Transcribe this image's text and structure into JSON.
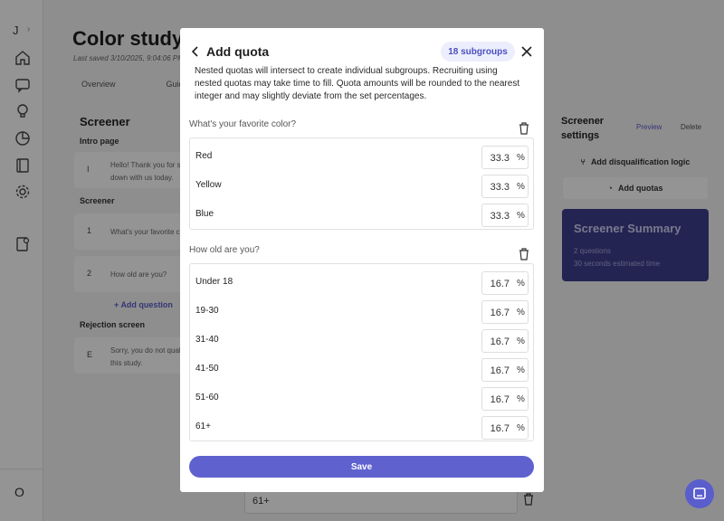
{
  "rail": {
    "workspace_initial": "J",
    "user_initial": "O",
    "icons": [
      "home-icon",
      "chat-icon",
      "lightbulb-icon",
      "pie-chart-icon",
      "book-icon",
      "gear-icon",
      "document-user-icon"
    ]
  },
  "page": {
    "title": "Color study",
    "last_saved": "Last saved 3/10/2025, 9:04:06 PM",
    "tabs": [
      "Overview",
      "Guide"
    ]
  },
  "screener": {
    "heading": "Screener",
    "intro_label": "Intro page",
    "intro_num": "I",
    "intro_text": "Hello! Thank you for sitting down with us today.",
    "screener_label": "Screener",
    "q1_num": "1",
    "q1_text": "What's your favorite color?",
    "q2_num": "2",
    "q2_text": "How old are you?",
    "add_question": "Add question",
    "rejection_label": "Rejection screen",
    "rejection_num": "E",
    "rejection_text": "Sorry, you do not qualify for this study.",
    "bottom_field_value": "61+"
  },
  "settings": {
    "title": "Screener settings",
    "preview": "Preview",
    "delete": "Delete",
    "add_disqualification": "Add disqualification logic",
    "add_quotas": "Add quotas",
    "summary_title": "Screener Summary",
    "summary_questions": "2 questions",
    "summary_time": "30 seconds estimated time"
  },
  "modal": {
    "title": "Add quota",
    "badge": "18 subgroups",
    "description": "Nested quotas will intersect to create individual subgroups. Recruiting using nested quotas may take time to fill. Quota amounts will be rounded to the nearest integer and may slightly deviate from the set percentages.",
    "questions": [
      {
        "label": "What's your favorite color?",
        "options": [
          {
            "name": "Red",
            "value": "33.3"
          },
          {
            "name": "Yellow",
            "value": "33.3"
          },
          {
            "name": "Blue",
            "value": "33.3"
          }
        ]
      },
      {
        "label": "How old are you?",
        "options": [
          {
            "name": "Under 18",
            "value": "16.7"
          },
          {
            "name": "19-30",
            "value": "16.7"
          },
          {
            "name": "31-40",
            "value": "16.7"
          },
          {
            "name": "41-50",
            "value": "16.7"
          },
          {
            "name": "51-60",
            "value": "16.7"
          },
          {
            "name": "61+",
            "value": "16.7"
          }
        ]
      }
    ],
    "percent_symbol": "%",
    "save_label": "Save"
  },
  "colors": {
    "accent": "#5f61cf",
    "summary_bg": "#3d3f8c",
    "badge_bg": "#eceefd"
  }
}
